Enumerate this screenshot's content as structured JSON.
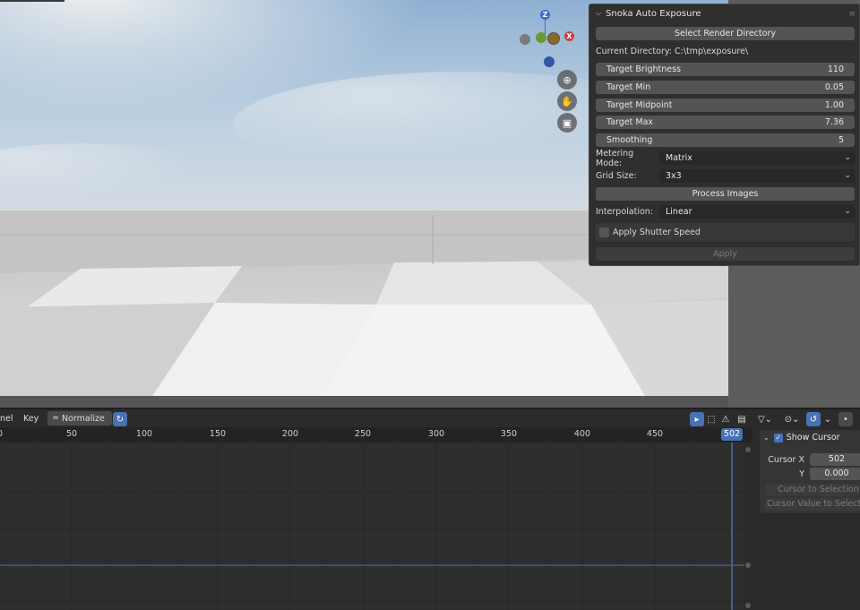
{
  "addon_panel": {
    "title": "Snoka Auto Exposure",
    "select_dir_button": "Select Render Directory",
    "current_directory": "Current Directory: C:\\tmp\\exposure\\",
    "fields": [
      {
        "label": "Target Brightness",
        "value": "110"
      },
      {
        "label": "Target Min",
        "value": "0.05"
      },
      {
        "label": "Target Midpoint",
        "value": "1.00"
      },
      {
        "label": "Target Max",
        "value": "7.36"
      },
      {
        "label": "Smoothing",
        "value": "5"
      }
    ],
    "metering_mode": {
      "label": "Metering Mode:",
      "value": "Matrix"
    },
    "grid_size": {
      "label": "Grid Size:",
      "value": "3x3"
    },
    "process_button": "Process Images",
    "interpolation": {
      "label": "Interpolation:",
      "value": "Linear"
    },
    "apply_shutter_label": "Apply Shutter Speed",
    "apply_shutter_checked": false,
    "apply_button": "Apply"
  },
  "viewport": {
    "gizmo": {
      "z": "Z",
      "x": "X"
    }
  },
  "graph_editor": {
    "menu_channel": "nel",
    "menu_key": "Key",
    "normalize_label": "Normalize",
    "ruler_ticks": [
      "0",
      "50",
      "100",
      "150",
      "200",
      "250",
      "300",
      "350",
      "400",
      "450"
    ],
    "current_frame": "502"
  },
  "sidebar": {
    "show_cursor_label": "Show Cursor",
    "show_cursor_checked": true,
    "cursor_x_label": "Cursor X",
    "cursor_x_value": "502",
    "cursor_y_label": "Y",
    "cursor_y_value": "0.000",
    "cursor_to_selection": "Cursor to Selection",
    "cursor_value_to_selection": "Cursor Value to Selection"
  },
  "colors": {
    "accent": "#4772b3",
    "gizmo_x": "#c94040",
    "gizmo_y": "#6b9a2e",
    "gizmo_z": "#3a6fc4"
  }
}
